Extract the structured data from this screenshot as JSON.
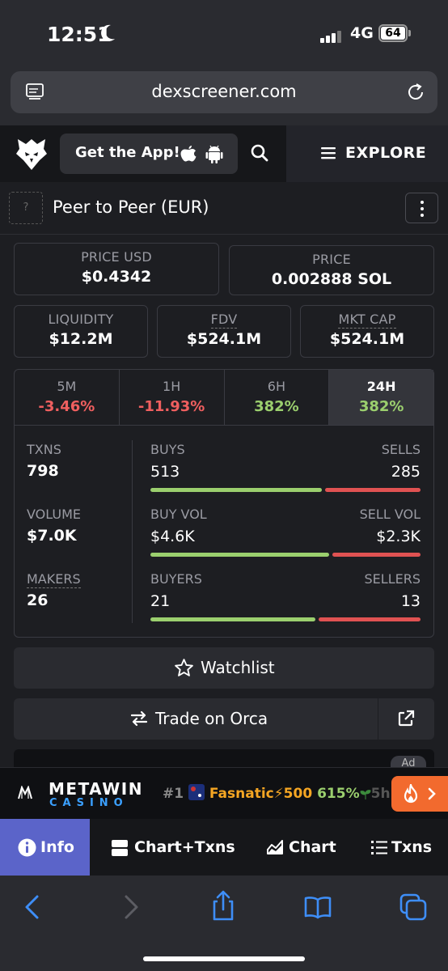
{
  "status_bar": {
    "time": "12:51",
    "network": "4G",
    "battery": "64"
  },
  "browser": {
    "url": "dexscreener.com"
  },
  "header": {
    "get_app_label": "Get the App!",
    "explore_label": "EXPLORE"
  },
  "pair": {
    "placeholder": "?",
    "name": "Peer to Peer (EUR)"
  },
  "prices": {
    "price_usd_label": "PRICE USD",
    "price_usd": "$0.4342",
    "price_label": "PRICE",
    "price": "0.002888 SOL"
  },
  "metrics": {
    "liquidity_label": "LIQUIDITY",
    "liquidity": "$12.2M",
    "fdv_label": "FDV",
    "fdv": "$524.1M",
    "mkt_cap_label": "MKT CAP",
    "mkt_cap": "$524.1M"
  },
  "timeframes": [
    {
      "label": "5M",
      "value": "-3.46%",
      "direction": "negative"
    },
    {
      "label": "1H",
      "value": "-11.93%",
      "direction": "negative"
    },
    {
      "label": "6H",
      "value": "382%",
      "direction": "positive"
    },
    {
      "label": "24H",
      "value": "382%",
      "direction": "positive",
      "selected": true
    }
  ],
  "stats": {
    "txns_label": "TXNS",
    "txns": "798",
    "volume_label": "VOLUME",
    "volume": "$7.0K",
    "makers_label": "MAKERS",
    "makers": "26",
    "buys_label": "BUYS",
    "buys": "513",
    "sells_label": "SELLS",
    "sells": "285",
    "buy_vol_label": "BUY VOL",
    "buy_vol": "$4.6K",
    "sell_vol_label": "SELL VOL",
    "sell_vol": "$2.3K",
    "buyers_label": "BUYERS",
    "buyers": "21",
    "sellers_label": "SELLERS",
    "sellers": "13",
    "buy_ratio_txns": 0.64,
    "buy_ratio_vol": 0.667,
    "buy_ratio_makers": 0.618
  },
  "actions": {
    "watchlist_label": "Watchlist",
    "trade_label": "Trade on Orca"
  },
  "ad": {
    "tag": "Ad",
    "brand": "METAWIN",
    "brand_sub": "CASINO",
    "rank": "#1",
    "token": "Fasnatic",
    "amount": "500",
    "change": "615%",
    "trail": "5h"
  },
  "tabs": [
    {
      "label": "Info",
      "icon": "info-icon",
      "active": true
    },
    {
      "label": "Chart+Txns",
      "icon": "chart-txns-icon"
    },
    {
      "label": "Chart",
      "icon": "chart-icon"
    },
    {
      "label": "Txns",
      "icon": "list-icon"
    }
  ],
  "colors": {
    "positive": "#9bcf6e",
    "negative": "#ef5f5f",
    "active_tab": "#5b64c9",
    "ad_accent": "#f26a2e"
  }
}
